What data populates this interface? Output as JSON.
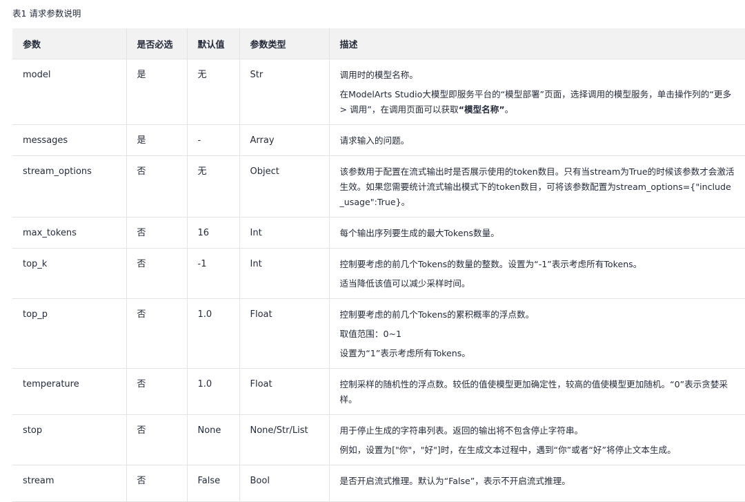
{
  "caption": "表1 请求参数说明",
  "table": {
    "headers": [
      "参数",
      "是否必选",
      "默认值",
      "参数类型",
      "描述"
    ],
    "rows": [
      {
        "param": "model",
        "required": "是",
        "default": "无",
        "type": "Str",
        "desc": [
          "调用时的模型名称。",
          "在ModelArts Studio大模型即服务平台的“模型部署”页面，选择调用的模型服务，单击操作列的“更多 > 调用”，在调用页面可以获取"
        ],
        "desc_bold": "“模型名称”",
        "desc_tail": "。"
      },
      {
        "param": "messages",
        "required": "是",
        "default": "-",
        "type": "Array",
        "desc": [
          "请求输入的问题。"
        ]
      },
      {
        "param": "stream_options",
        "required": "否",
        "default": "无",
        "type": "Object",
        "desc": [
          "该参数用于配置在流式输出时是否展示使用的token数目。只有当stream为True的时候该参数才会激活生效。如果您需要统计流式输出模式下的token数目，可将该参数配置为stream_options={\"include_usage\":True}。"
        ]
      },
      {
        "param": "max_tokens",
        "required": "否",
        "default": "16",
        "type": "Int",
        "desc": [
          "每个输出序列要生成的最大Tokens数量。"
        ]
      },
      {
        "param": "top_k",
        "required": "否",
        "default": "-1",
        "type": "Int",
        "desc": [
          "控制要考虑的前几个Tokens的数量的整数。设置为“-1”表示考虑所有Tokens。",
          "适当降低该值可以减少采样时间。"
        ]
      },
      {
        "param": "top_p",
        "required": "否",
        "default": "1.0",
        "type": "Float",
        "desc": [
          "控制要考虑的前几个Tokens的累积概率的浮点数。",
          "取值范围：0~1",
          "设置为“1”表示考虑所有Tokens。"
        ]
      },
      {
        "param": "temperature",
        "required": "否",
        "default": "1.0",
        "type": "Float",
        "desc": [
          "控制采样的随机性的浮点数。较低的值使模型更加确定性，较高的值使模型更加随机。“0”表示贪婪采样。"
        ]
      },
      {
        "param": "stop",
        "required": "否",
        "default": "None",
        "type": "None/Str/List",
        "desc": [
          "用于停止生成的字符串列表。返回的输出将不包含停止字符串。",
          "例如，设置为[\"你\"，\"好\"]时，在生成文本过程中，遇到“你”或者“好”将停止文本生成。"
        ]
      },
      {
        "param": "stream",
        "required": "否",
        "default": "False",
        "type": "Bool",
        "desc": [
          "是否开启流式推理。默认为“False”，表示不开启流式推理。"
        ]
      }
    ]
  }
}
